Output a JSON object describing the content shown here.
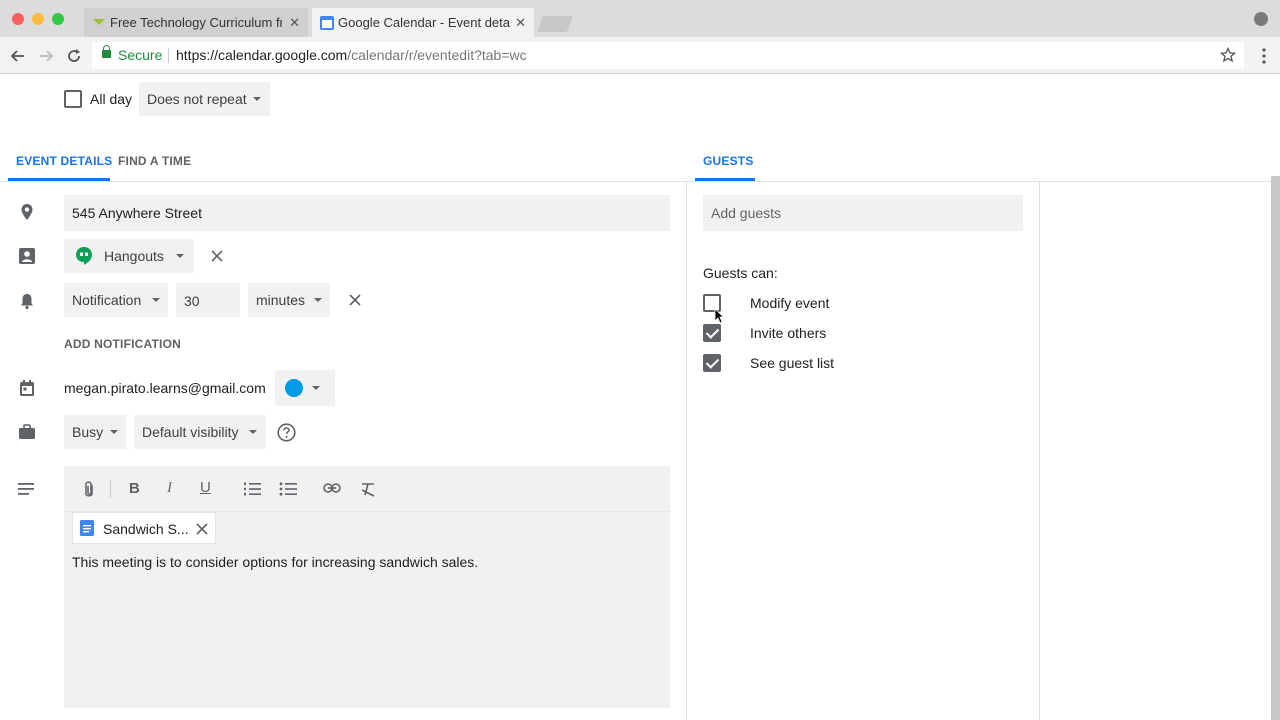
{
  "browser": {
    "tabs": [
      {
        "title": "Free Technology Curriculum fr",
        "active": false
      },
      {
        "title": "Google Calendar - Event detail",
        "active": true
      }
    ],
    "tab_close": "✕",
    "secure_label": "Secure",
    "url_host": "https://calendar.google.com",
    "url_path": "/calendar/r/eventedit?tab=wc"
  },
  "event": {
    "all_day_label": "All day",
    "repeat_value": "Does not repeat",
    "tabs": [
      "EVENT DETAILS",
      "FIND A TIME"
    ],
    "location": "545 Anywhere Street",
    "conferencing": "Hangouts",
    "notification_type": "Notification",
    "notification_amount": "30",
    "notification_unit": "minutes",
    "add_notification": "ADD NOTIFICATION",
    "calendar_owner": "megan.pirato.learns@gmail.com",
    "calendar_color": "#039be5",
    "availability": "Busy",
    "visibility": "Default visibility",
    "attachment_name": "Sandwich S...",
    "description": "This meeting is to consider options for increasing sandwich sales."
  },
  "guests": {
    "tab_label": "GUESTS",
    "add_placeholder": "Add guests",
    "can_label": "Guests can:",
    "permissions": [
      {
        "label": "Modify event",
        "checked": false
      },
      {
        "label": "Invite others",
        "checked": true
      },
      {
        "label": "See guest list",
        "checked": true
      }
    ]
  },
  "colors": {
    "accent": "#1a73e8",
    "hangouts_green": "#0f9d58",
    "doc_blue": "#4285f4"
  },
  "icons": {
    "location": "location-pin-icon",
    "conference": "people-icon",
    "notification": "bell-icon",
    "calendar": "calendar-icon",
    "availability": "briefcase-icon",
    "description": "text-lines-icon",
    "help": "help-circle-icon"
  }
}
